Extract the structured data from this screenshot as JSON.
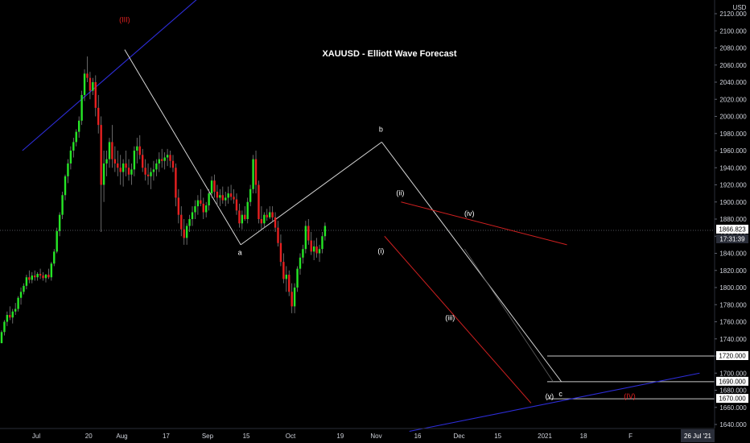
{
  "chart_data": {
    "type": "candlestick",
    "title": "XAUUSD - Elliott Wave Forecast",
    "currency_label": "USD",
    "ylim": [
      1630,
      2130
    ],
    "y_ticks": [
      1640,
      1660,
      1680,
      1700,
      1720,
      1740,
      1760,
      1780,
      1800,
      1820,
      1840,
      1860,
      1880,
      1900,
      1920,
      1940,
      1960,
      1980,
      2000,
      2020,
      2040,
      2060,
      2080,
      2100,
      2120
    ],
    "y_tick_labels": [
      "1640.000",
      "1660.000",
      "1680.000",
      "1700.000",
      "1720.000",
      "1740.000",
      "1760.000",
      "1780.000",
      "1800.000",
      "1820.000",
      "1840.000",
      "1860.000",
      "1880.000",
      "1900.000",
      "1920.000",
      "1940.000",
      "1960.000",
      "1980.000",
      "2000.000",
      "2020.000",
      "2040.000",
      "2060.000",
      "2080.000",
      "2100.000",
      "2120.000"
    ],
    "x_ticks": [
      {
        "day": 0,
        "label": "Jul"
      },
      {
        "day": 19,
        "label": "20"
      },
      {
        "day": 31,
        "label": "Aug"
      },
      {
        "day": 47,
        "label": "17"
      },
      {
        "day": 62,
        "label": "Sep"
      },
      {
        "day": 76,
        "label": "15"
      },
      {
        "day": 92,
        "label": "Oct"
      },
      {
        "day": 110,
        "label": "19"
      },
      {
        "day": 123,
        "label": "Nov"
      },
      {
        "day": 138,
        "label": "16"
      },
      {
        "day": 153,
        "label": "Dec"
      },
      {
        "day": 167,
        "label": "15"
      },
      {
        "day": 184,
        "label": "2021"
      },
      {
        "day": 198,
        "label": "18"
      },
      {
        "day": 215,
        "label": "F"
      }
    ],
    "x_range_days": [
      0,
      222
    ],
    "bullish_color": "#26e626",
    "bearish_color": "#e62020",
    "candles": [
      [
        1735,
        1750,
        1735,
        1748
      ],
      [
        1748,
        1762,
        1744,
        1760
      ],
      [
        1760,
        1772,
        1755,
        1768
      ],
      [
        1768,
        1778,
        1762,
        1765
      ],
      [
        1765,
        1775,
        1758,
        1772
      ],
      [
        1772,
        1782,
        1768,
        1775
      ],
      [
        1775,
        1790,
        1772,
        1788
      ],
      [
        1788,
        1800,
        1780,
        1795
      ],
      [
        1795,
        1805,
        1792,
        1802
      ],
      [
        1802,
        1815,
        1798,
        1812
      ],
      [
        1812,
        1820,
        1805,
        1809
      ],
      [
        1809,
        1818,
        1805,
        1814
      ],
      [
        1814,
        1820,
        1808,
        1812
      ],
      [
        1812,
        1818,
        1808,
        1816
      ],
      [
        1816,
        1822,
        1810,
        1814
      ],
      [
        1814,
        1818,
        1808,
        1811
      ],
      [
        1811,
        1816,
        1806,
        1815
      ],
      [
        1815,
        1822,
        1810,
        1812
      ],
      [
        1812,
        1830,
        1808,
        1828
      ],
      [
        1828,
        1845,
        1825,
        1842
      ],
      [
        1842,
        1870,
        1840,
        1866
      ],
      [
        1866,
        1888,
        1860,
        1885
      ],
      [
        1885,
        1912,
        1880,
        1908
      ],
      [
        1908,
        1932,
        1902,
        1930
      ],
      [
        1930,
        1950,
        1922,
        1945
      ],
      [
        1945,
        1965,
        1938,
        1960
      ],
      [
        1960,
        1975,
        1952,
        1970
      ],
      [
        1970,
        1985,
        1965,
        1982
      ],
      [
        1982,
        2000,
        1975,
        1995
      ],
      [
        1995,
        2030,
        1990,
        2025
      ],
      [
        2025,
        2055,
        2018,
        2050
      ],
      [
        2050,
        2070,
        2040,
        2045
      ],
      [
        2045,
        2052,
        2020,
        2030
      ],
      [
        2030,
        2045,
        2025,
        2040
      ],
      [
        2040,
        2048,
        2000,
        2010
      ],
      [
        2010,
        2025,
        1980,
        1990
      ],
      [
        1990,
        2000,
        1865,
        1920
      ],
      [
        1920,
        1960,
        1900,
        1945
      ],
      [
        1945,
        1960,
        1930,
        1950
      ],
      [
        1950,
        1975,
        1940,
        1970
      ],
      [
        1970,
        1990,
        1940,
        1950
      ],
      [
        1950,
        1965,
        1935,
        1945
      ],
      [
        1945,
        1960,
        1930,
        1940
      ],
      [
        1940,
        1955,
        1920,
        1935
      ],
      [
        1935,
        1950,
        1918,
        1945
      ],
      [
        1945,
        1960,
        1930,
        1940
      ],
      [
        1940,
        1950,
        1925,
        1932
      ],
      [
        1932,
        1945,
        1920,
        1938
      ],
      [
        1938,
        1965,
        1930,
        1960
      ],
      [
        1960,
        1975,
        1945,
        1965
      ],
      [
        1965,
        1978,
        1950,
        1955
      ],
      [
        1955,
        1962,
        1935,
        1940
      ],
      [
        1940,
        1950,
        1925,
        1932
      ],
      [
        1932,
        1945,
        1920,
        1930
      ],
      [
        1930,
        1940,
        1915,
        1935
      ],
      [
        1935,
        1948,
        1925,
        1938
      ],
      [
        1938,
        1950,
        1930,
        1945
      ],
      [
        1945,
        1958,
        1935,
        1950
      ],
      [
        1950,
        1962,
        1940,
        1948
      ],
      [
        1948,
        1958,
        1938,
        1952
      ],
      [
        1952,
        1962,
        1942,
        1955
      ],
      [
        1955,
        1960,
        1940,
        1948
      ],
      [
        1948,
        1955,
        1935,
        1940
      ],
      [
        1940,
        1945,
        1895,
        1905
      ],
      [
        1905,
        1915,
        1875,
        1885
      ],
      [
        1885,
        1895,
        1860,
        1868
      ],
      [
        1868,
        1880,
        1850,
        1858
      ],
      [
        1858,
        1875,
        1850,
        1872
      ],
      [
        1872,
        1885,
        1865,
        1880
      ],
      [
        1880,
        1895,
        1872,
        1888
      ],
      [
        1888,
        1902,
        1880,
        1895
      ],
      [
        1895,
        1908,
        1885,
        1902
      ],
      [
        1902,
        1915,
        1895,
        1898
      ],
      [
        1898,
        1905,
        1880,
        1888
      ],
      [
        1888,
        1900,
        1882,
        1896
      ],
      [
        1896,
        1915,
        1890,
        1910
      ],
      [
        1910,
        1930,
        1905,
        1925
      ],
      [
        1925,
        1932,
        1905,
        1912
      ],
      [
        1912,
        1920,
        1895,
        1905
      ],
      [
        1905,
        1915,
        1895,
        1908
      ],
      [
        1908,
        1918,
        1898,
        1902
      ],
      [
        1902,
        1912,
        1895,
        1905
      ],
      [
        1905,
        1918,
        1898,
        1910
      ],
      [
        1910,
        1920,
        1902,
        1906
      ],
      [
        1906,
        1915,
        1898,
        1903
      ],
      [
        1903,
        1910,
        1885,
        1890
      ],
      [
        1890,
        1898,
        1870,
        1875
      ],
      [
        1875,
        1890,
        1868,
        1885
      ],
      [
        1885,
        1895,
        1878,
        1880
      ],
      [
        1880,
        1905,
        1875,
        1900
      ],
      [
        1900,
        1920,
        1895,
        1915
      ],
      [
        1915,
        1955,
        1910,
        1950
      ],
      [
        1950,
        1960,
        1910,
        1920
      ],
      [
        1920,
        1925,
        1875,
        1880
      ],
      [
        1880,
        1895,
        1868,
        1875
      ],
      [
        1875,
        1888,
        1870,
        1885
      ],
      [
        1885,
        1892,
        1878,
        1882
      ],
      [
        1882,
        1895,
        1880,
        1888
      ],
      [
        1888,
        1895,
        1878,
        1882
      ],
      [
        1882,
        1888,
        1865,
        1870
      ],
      [
        1870,
        1878,
        1848,
        1852
      ],
      [
        1852,
        1862,
        1825,
        1830
      ],
      [
        1830,
        1840,
        1805,
        1810
      ],
      [
        1810,
        1825,
        1795,
        1815
      ],
      [
        1815,
        1820,
        1790,
        1795
      ],
      [
        1795,
        1805,
        1770,
        1778
      ],
      [
        1778,
        1805,
        1770,
        1800
      ],
      [
        1800,
        1825,
        1795,
        1822
      ],
      [
        1822,
        1840,
        1815,
        1835
      ],
      [
        1835,
        1850,
        1828,
        1845
      ],
      [
        1845,
        1878,
        1840,
        1872
      ],
      [
        1872,
        1880,
        1850,
        1855
      ],
      [
        1855,
        1865,
        1838,
        1842
      ],
      [
        1842,
        1855,
        1832,
        1848
      ],
      [
        1848,
        1858,
        1835,
        1840
      ],
      [
        1840,
        1850,
        1830,
        1845
      ],
      [
        1845,
        1865,
        1840,
        1860
      ],
      [
        1860,
        1876,
        1855,
        1872
      ]
    ],
    "current_price": {
      "value": 1866.823,
      "label": "1866.823",
      "countdown": "17:31:39"
    },
    "level_labels": [
      {
        "value": 1720,
        "label": "1720.000"
      },
      {
        "value": 1690,
        "label": "1690.000"
      },
      {
        "value": 1670,
        "label": "1670.000"
      }
    ],
    "wave_labels": [
      {
        "text": "(III)",
        "day": 32,
        "value": 2110,
        "color": "#e62020"
      },
      {
        "text": "a",
        "day": 74,
        "value": 1838,
        "color": "#ffffff"
      },
      {
        "text": "b",
        "day": 125,
        "value": 1982,
        "color": "#ffffff"
      },
      {
        "text": "(ii)",
        "day": 132,
        "value": 1908,
        "color": "#ffffff"
      },
      {
        "text": "(i)",
        "day": 125,
        "value": 1840,
        "color": "#ffffff"
      },
      {
        "text": "(iv)",
        "day": 157,
        "value": 1884,
        "color": "#ffffff"
      },
      {
        "text": "(iii)",
        "day": 150,
        "value": 1762,
        "color": "#ffffff"
      },
      {
        "text": "(v)",
        "day": 186,
        "value": 1670,
        "color": "#ffffff"
      },
      {
        "text": "c",
        "day": 190,
        "value": 1673,
        "color": "#ffffff"
      },
      {
        "text": "(IV)",
        "day": 215,
        "value": 1670,
        "color": "#e62020"
      }
    ],
    "date_badge": "26 Jul '21"
  }
}
